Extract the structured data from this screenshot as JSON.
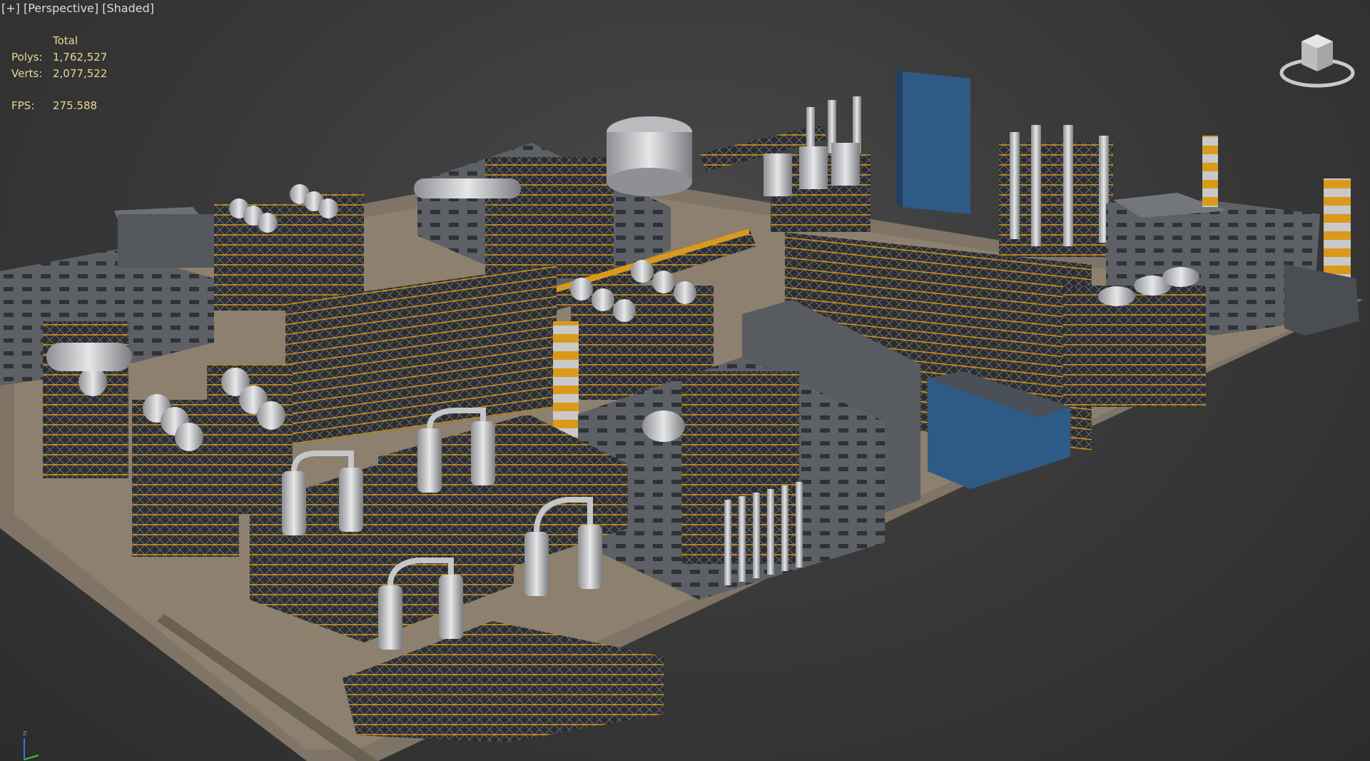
{
  "viewport_label": {
    "plus": "[+]",
    "view": "[Perspective]",
    "shading": "[Shaded]"
  },
  "stats": {
    "header": "Total",
    "polys_label": "Polys:",
    "polys_value": "1,762,527",
    "verts_label": "Verts:",
    "verts_value": "2,077,522",
    "fps_label": "FPS:",
    "fps_value": "275.588"
  },
  "axis_tripod": {
    "z_label": "z"
  },
  "colors": {
    "background": "#3a3a3a",
    "ground": "#8a7d6c",
    "building": "#5d6166",
    "accent_orange": "#d99a1c",
    "steel": "#c4c6c8",
    "blue_building": "#2e5a86",
    "overlay_text": "#e8d890"
  }
}
